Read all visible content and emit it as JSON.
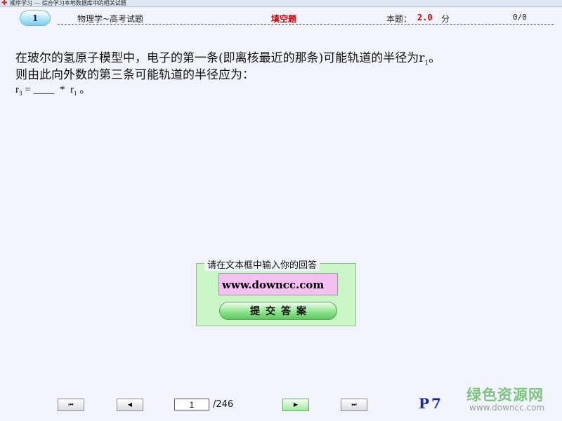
{
  "window": {
    "title": "顺序学习 --- 综合学习本地数据库中的相关试题",
    "icon": "plus-icon"
  },
  "header": {
    "question_number": "1",
    "subject": "物理学~高考试题",
    "question_type": "填空题",
    "score_label": "本题：",
    "score_value": "2.0",
    "score_unit": "分",
    "progress": "0/0"
  },
  "question": {
    "line1": "在玻尔的氢原子模型中，电子的第一条(即离核最近的那条)可能轨道的半径为r",
    "line1_sub": "1",
    "line1_end": "。",
    "line2": "则由此向外数的第三条可能轨道的半径应为：",
    "formula_r": "r",
    "formula_r_sub": "3",
    "formula_mid": " = ____  *  r",
    "formula_r1_sub": "1",
    "formula_end": " 。"
  },
  "answer": {
    "legend": "请在文本框中输入你的回答",
    "value": "www.downcc.com",
    "submit_label": "提交答案"
  },
  "navigation": {
    "first_symbol": "⏮",
    "prev_symbol": "◀",
    "next_symbol": "▶",
    "last_symbol": "⏭",
    "current_page": "1",
    "total_pages": "/246",
    "page_marker": "P7"
  },
  "watermark": {
    "logo_text": "绿色资源网",
    "url": "www.downcc.com"
  },
  "colors": {
    "accent_red": "#cc0000",
    "panel_green": "#c9f5c9",
    "input_pink": "#f6c0f3",
    "marker_blue": "#1b2d8f"
  }
}
